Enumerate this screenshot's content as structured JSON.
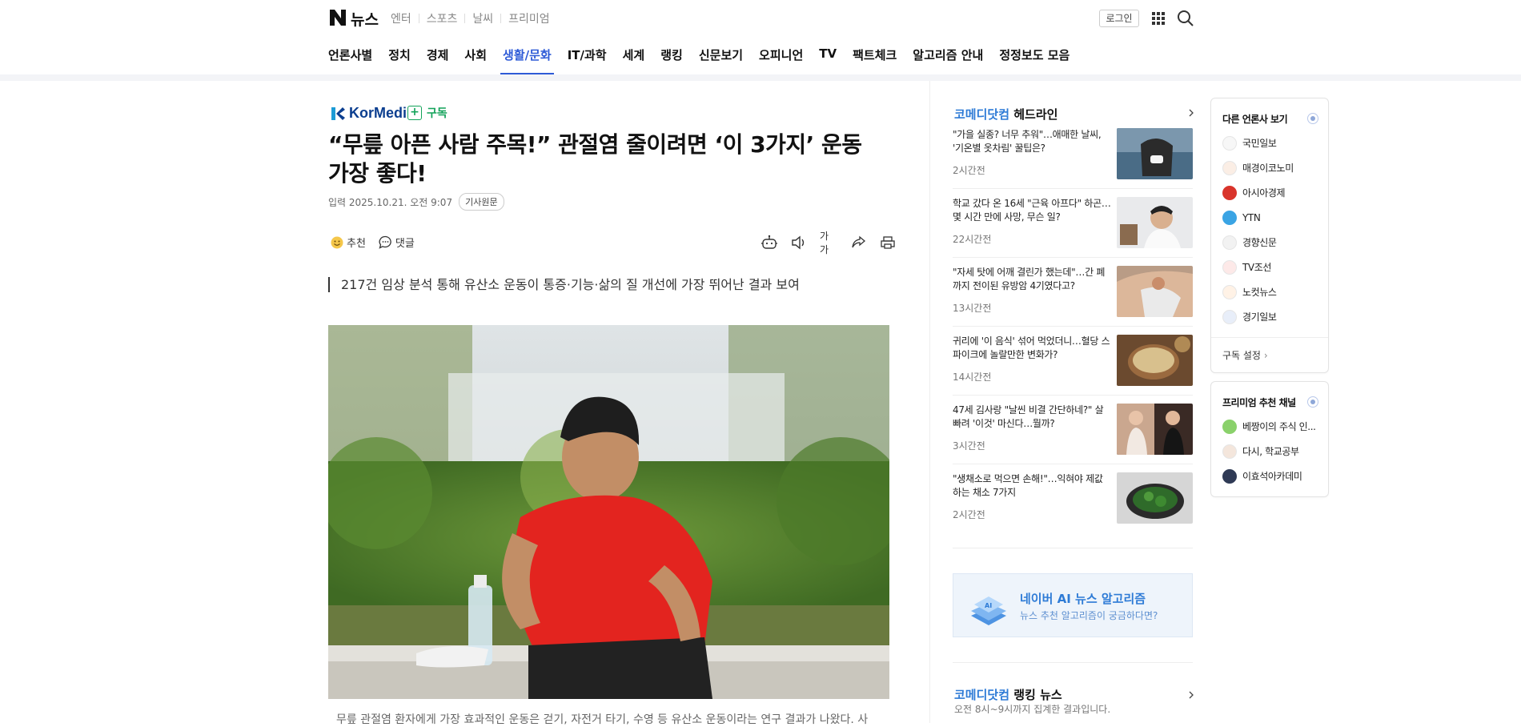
{
  "header": {
    "logo_n": "N",
    "logo_text": "뉴스",
    "top_links": [
      "엔터",
      "스포츠",
      "날씨",
      "프리미엄"
    ],
    "login": "로그인",
    "nav": [
      "언론사별",
      "정치",
      "경제",
      "사회",
      "생활/문화",
      "IT/과학",
      "세계",
      "랭킹",
      "신문보기",
      "오피니언",
      "TV",
      "팩트체크",
      "알고리즘 안내",
      "정정보도 모음"
    ],
    "active_nav": "생활/문화"
  },
  "article": {
    "press": "KorMedi",
    "subscribe": "구독",
    "title": "“무릎 아픈 사람 주목!” 관절염 줄이려면 ‘이 3가지’ 운동 가장 좋다!",
    "date": "입력 2025.10.21. 오전 9:07",
    "original_button": "기사원문",
    "recommend": "추천",
    "comment": "댓글",
    "font_size_tool": "가가",
    "summary": "217건 임상 분석 통해 유산소 운동이 통증·기능·삶의 질 개선에 가장 뛰어난 결과 보여",
    "caption": "무릎 관절염 환자에게 가장 효과적인 운동은 걷기, 자전거 타기, 수영 등 유산소 운동이라는 연구 결과가 나왔다. 사"
  },
  "headlines": {
    "brand": "코메디닷컴",
    "title": "헤드라인",
    "items": [
      {
        "text": "\"가을 실종? 너무 추워\"…애매한 날씨, '기온별 옷차림' 꿀팁은?",
        "time": "2시간전"
      },
      {
        "text": "학교 갔다 온 16세 \"근육 아프다\" 하곤…몇 시간 만에 사망, 무슨 일?",
        "time": "22시간전"
      },
      {
        "text": "\"자세 탓에 어깨 결린가 했는데\"…간 폐까지 전이된 유방암 4기였다고?",
        "time": "13시간전"
      },
      {
        "text": "귀리에 '이 음식' 섞어 먹었더니…혈당 스파이크에 놀랄만한 변화가?",
        "time": "14시간전"
      },
      {
        "text": "47세 김사랑 \"날씬 비결 간단하네?\" 살 빠려 '이것' 마신다…뭘까?",
        "time": "3시간전"
      },
      {
        "text": "\"생채소로 먹으면 손해!\"…익혀야 제값 하는 채소 7가지",
        "time": "2시간전"
      }
    ]
  },
  "ai_banner": {
    "title": "네이버 AI 뉴스 알고리즘",
    "subtitle": "뉴스 추천 알고리즘이 궁금하다면?"
  },
  "ranking": {
    "brand": "코메디닷컴",
    "title": "랭킹 뉴스",
    "subtitle": "오전 8시~9시까지 집계한 결과입니다."
  },
  "other_press": {
    "title": "다른 언론사 보기",
    "items": [
      "국민일보",
      "매경이코노미",
      "아시아경제",
      "YTN",
      "경향신문",
      "TV조선",
      "노컷뉴스",
      "경기일보"
    ],
    "setting": "구독 설정"
  },
  "premium": {
    "title": "프리미엄 추천 채널",
    "items": [
      "베짱이의 주식 인...",
      "다시, 학교공부",
      "이효석아카데미"
    ]
  },
  "colors": {
    "accent": "#2e5bd7",
    "brand": "#2e7bd6",
    "subscribe": "#13a35a"
  }
}
